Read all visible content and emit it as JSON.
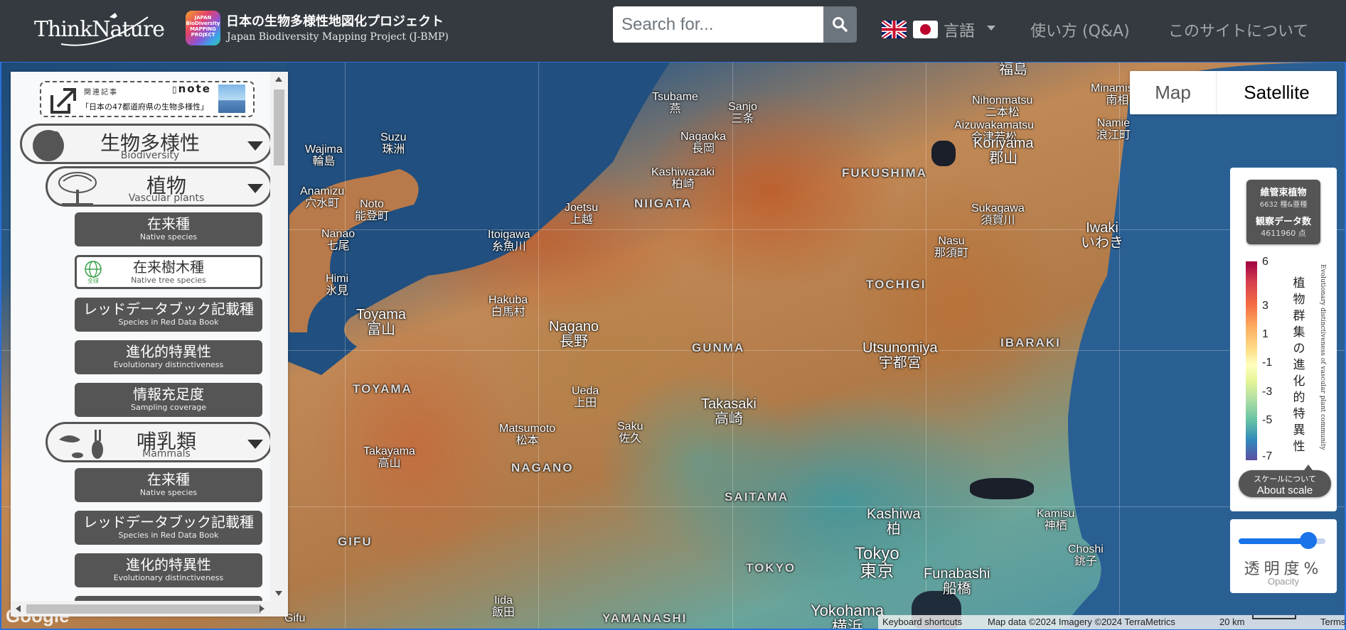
{
  "header": {
    "brand": "ThinkNature",
    "project_icon_text": "JAPAN BioDiversity MAPPING PROJECT",
    "project_title": "日本の生物多様性地図化プロジェクト",
    "project_subtitle": "Japan Biodiversity Mapping Project (J-BMP)",
    "search": {
      "placeholder": "Search for..."
    },
    "language_label": "言語",
    "nav": [
      {
        "label": "使い方 (Q&A)"
      },
      {
        "label": "このサイトについて"
      }
    ]
  },
  "sidebar": {
    "note_card": {
      "heading": "関連記事",
      "brand": "note",
      "title": "「日本の47都道府県の生物多様性」"
    },
    "biodiversity": {
      "ja": "生物多様性",
      "en": "Biodiversity"
    },
    "plants": {
      "ja": "植物",
      "en": "Vascular plants",
      "items": [
        {
          "ja": "在来種",
          "en": "Native species"
        },
        {
          "ja": "在来樹木種",
          "en": "Native tree species",
          "badge": "全球"
        },
        {
          "ja": "レッドデータブック記載種",
          "en": "Species in Red Data Book"
        },
        {
          "ja": "進化的特異性",
          "en": "Evolutionary distinctiveness"
        },
        {
          "ja": "情報充足度",
          "en": "Sampling coverage"
        }
      ]
    },
    "mammals": {
      "ja": "哺乳類",
      "en": "Mammals",
      "items": [
        {
          "ja": "在来種",
          "en": "Native species"
        },
        {
          "ja": "レッドデータブック記載種",
          "en": "Species in Red Data Book"
        },
        {
          "ja": "進化的特異性",
          "en": "Evolutionary distinctiveness"
        }
      ]
    }
  },
  "map": {
    "map_type": {
      "map": "Map",
      "satellite": "Satellite",
      "selected": "Satellite"
    },
    "places": [
      {
        "en": "Tsubame",
        "ja": "燕"
      },
      {
        "en": "Sanjo",
        "ja": "三条"
      },
      {
        "en": "Nagaoka",
        "ja": "長岡"
      },
      {
        "en": "Kashiwazaki",
        "ja": "柏崎"
      },
      {
        "en": "Wajima",
        "ja": "輪島"
      },
      {
        "en": "Suzu",
        "ja": "珠洲"
      },
      {
        "en": "Noto",
        "ja": "能登町"
      },
      {
        "en": "Anamizu",
        "ja": "穴水町"
      },
      {
        "en": "Nanao",
        "ja": "七尾"
      },
      {
        "en": "Himi",
        "ja": "氷見"
      },
      {
        "en": "Joetsu",
        "ja": "上越"
      },
      {
        "en": "Itoigawa",
        "ja": "糸魚川"
      },
      {
        "en": "Toyama",
        "ja": "富山"
      },
      {
        "en": "Hakuba",
        "ja": "白馬村"
      },
      {
        "en": "Nagano",
        "ja": "長野"
      },
      {
        "en": "Ueda",
        "ja": "上田"
      },
      {
        "en": "Saku",
        "ja": "佐久"
      },
      {
        "en": "Matsumoto",
        "ja": "松本"
      },
      {
        "en": "Takayama",
        "ja": "高山"
      },
      {
        "en": "Takasaki",
        "ja": "高崎"
      },
      {
        "en": "Utsunomiya",
        "ja": "宇都宮"
      },
      {
        "en": "Kashiwa",
        "ja": "柏"
      },
      {
        "en": "Kamisu",
        "ja": "神栖"
      },
      {
        "en": "Choshi",
        "ja": "銚子"
      },
      {
        "en": "Tokyo",
        "ja": "東京"
      },
      {
        "en": "Funabashi",
        "ja": "船橋"
      },
      {
        "en": "Yokohama",
        "ja": "横浜"
      },
      {
        "en": "Iida",
        "ja": "飯田"
      },
      {
        "en": "Gifu",
        "ja": ""
      },
      {
        "en": "Aizuwakamatsu",
        "ja": "会津若松"
      },
      {
        "en": "Koriyama",
        "ja": "郡山"
      },
      {
        "en": "Sukagawa",
        "ja": "須賀川"
      },
      {
        "en": "Nasu",
        "ja": "那須町"
      },
      {
        "en": "Iwaki",
        "ja": "いわき"
      },
      {
        "en": "Nihonmatsu",
        "ja": "二本松"
      },
      {
        "en": "Minamisoma",
        "ja": "南相馬"
      },
      {
        "en": "Namie",
        "ja": "浪江町"
      },
      {
        "en": "Fukushima",
        "ja": "福島"
      }
    ],
    "prefectures": [
      "NIIGATA",
      "FUKUSHIMA",
      "TOCHIGI",
      "IBARAKI",
      "GUNMA",
      "TOYAMA",
      "NAGANO",
      "SAITAMA",
      "TOKYO",
      "GIFU",
      "YAMANASHI"
    ],
    "attribution": {
      "shortcuts": "Keyboard shortcuts",
      "data": "Map data ©2024 Imagery ©2024 TerraMetrics",
      "scale": "20 km",
      "terms": "Terms"
    },
    "google": "Google"
  },
  "legend": {
    "taxon": "維管束植物",
    "species_count": "6632 種&亜種",
    "obs_label": "観察データ数",
    "obs_count": "4611960 点",
    "ticks": [
      "6",
      "3",
      "1",
      "-1",
      "-3",
      "-5",
      "-7"
    ],
    "title_ja": "植物群集の進化的特異性",
    "title_en": "Evolutionary distinctiveness of vascular plant community",
    "about_ja": "スケールについて",
    "about_en": "About scale"
  },
  "opacity": {
    "label": "透明度%",
    "sub": "Opacity",
    "value": 0.8
  }
}
